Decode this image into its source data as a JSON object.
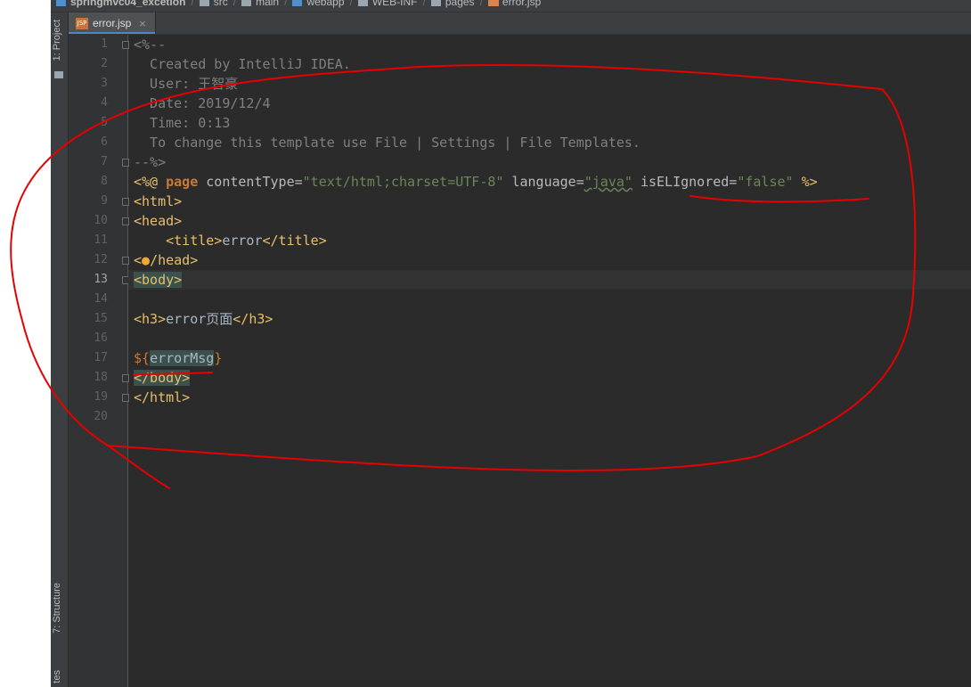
{
  "breadcrumb": {
    "items": [
      {
        "label": "springmvc04_excetion",
        "icon": "module-folder-icon",
        "bold": true
      },
      {
        "label": "src",
        "icon": "folder-icon"
      },
      {
        "label": "main",
        "icon": "folder-icon"
      },
      {
        "label": "webapp",
        "icon": "web-folder-icon"
      },
      {
        "label": "WEB-INF",
        "icon": "folder-icon"
      },
      {
        "label": "pages",
        "icon": "folder-icon"
      },
      {
        "label": "error.jsp",
        "icon": "jsp-file-icon"
      }
    ],
    "separator": "/"
  },
  "toolwindows": {
    "project_label": "1: Project",
    "structure_label": "7: Structure",
    "favorites_label": "tes"
  },
  "tabs": [
    {
      "label": "error.jsp",
      "icon": "jsp-file-icon",
      "close": "×",
      "active": true
    }
  ],
  "editor": {
    "line_numbers": [
      "1",
      "2",
      "3",
      "4",
      "5",
      "6",
      "7",
      "8",
      "9",
      "10",
      "11",
      "12",
      "13",
      "14",
      "15",
      "16",
      "17",
      "18",
      "19",
      "20"
    ],
    "current_line": 13,
    "code": {
      "l1": "<%--",
      "l2": "  Created by IntelliJ IDEA.",
      "l3": "  User: 王智豪",
      "l4": "  Date: 2019/12/4",
      "l5": "  Time: 0:13",
      "l6": "  To change this template use File | Settings | File Templates.",
      "l7": "--%>",
      "l8": {
        "open": "<%@ ",
        "directive": "page",
        "attr1": " contentType=",
        "val1": "\"text/html;charset=UTF-8\"",
        "attr2": " language=",
        "val2": "\"java\"",
        "attr3": " isELIgnored=",
        "val3": "\"false\"",
        "close": " %>"
      },
      "l9": "<html>",
      "l10": "<head>",
      "l11": {
        "indent": "    ",
        "open": "<title>",
        "text": "error",
        "close": "</title>"
      },
      "l12": {
        "a": "<",
        "b": "/head>"
      },
      "l13": "<body>",
      "l14": "",
      "l15": {
        "open": "<h3>",
        "text": "error页面",
        "close": "</h3>"
      },
      "l16": "",
      "l17": {
        "open": "${",
        "expr": "errorMsg",
        "close": "}"
      },
      "l18": "</body>",
      "l19": "</html>",
      "l20": ""
    }
  },
  "colors": {
    "background": "#2b2b2b",
    "comment": "#808080",
    "tag": "#e8bf6a",
    "keyword": "#cc7832",
    "string": "#6a8759",
    "annotation": "#e60000"
  }
}
